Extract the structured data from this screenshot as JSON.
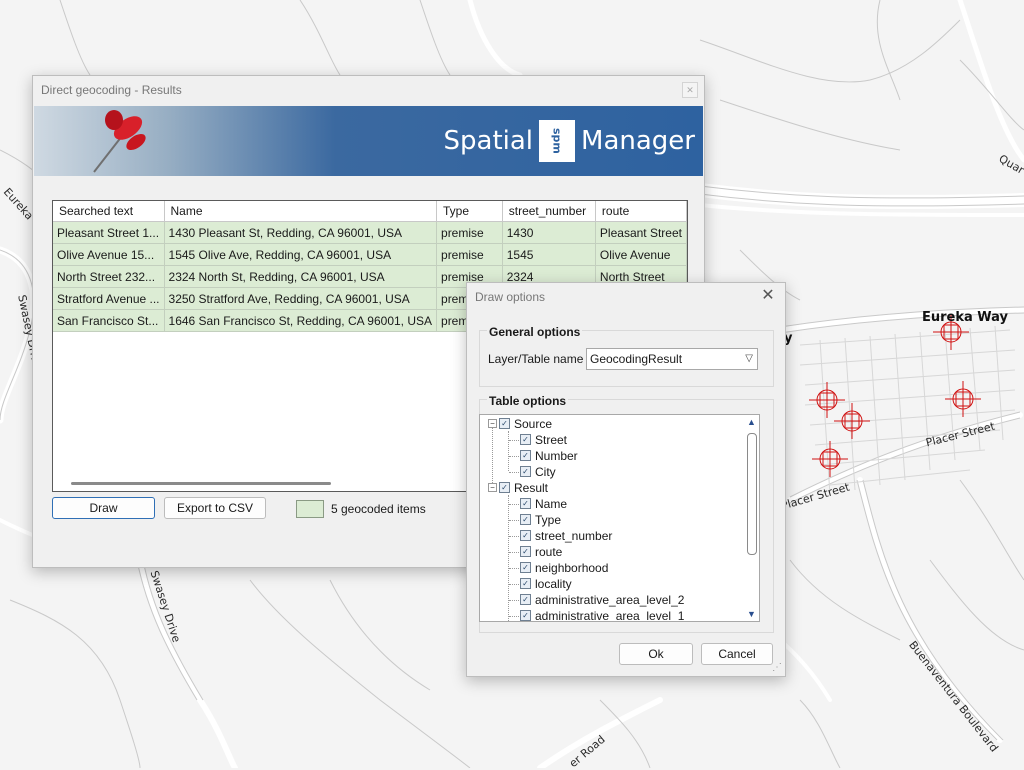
{
  "map": {
    "labels": [
      "Eureka Way",
      "Placer Street",
      "Placer Street",
      "Swasey Drive",
      "Swasey Drive",
      "Buenaventura Boulevard",
      "Eureka Wa",
      "Quar",
      "y",
      "er Road"
    ]
  },
  "results_dialog": {
    "title": "Direct geocoding - Results",
    "brand_left": "Spatial",
    "brand_badge": "spm",
    "brand_right": "Manager",
    "columns": [
      "Searched text",
      "Name",
      "Type",
      "street_number",
      "route"
    ],
    "rows": [
      [
        "Pleasant Street 1...",
        "1430 Pleasant St, Redding, CA 96001, USA",
        "premise",
        "1430",
        "Pleasant Street"
      ],
      [
        "Olive Avenue 15...",
        "1545 Olive Ave, Redding, CA 96001, USA",
        "premise",
        "1545",
        "Olive Avenue"
      ],
      [
        "North Street 232...",
        "2324 North St, Redding, CA 96001, USA",
        "premise",
        "2324",
        "North Street"
      ],
      [
        "Stratford Avenue ...",
        "3250 Stratford Ave, Redding, CA 96001, USA",
        "premise",
        "",
        ""
      ],
      [
        "San Francisco St...",
        "1646 San Francisco St, Redding, CA 96001, USA",
        "premise",
        "",
        ""
      ]
    ],
    "draw_label": "Draw",
    "export_label": "Export to CSV",
    "status": "5 geocoded items"
  },
  "draw_options": {
    "title": "Draw options",
    "general_title": "General options",
    "layer_label": "Layer/Table name",
    "layer_value": "GeocodingResult",
    "table_title": "Table options",
    "tree": {
      "source": "Source",
      "source_items": [
        "Street",
        "Number",
        "City"
      ],
      "result": "Result",
      "result_items": [
        "Name",
        "Type",
        "street_number",
        "route",
        "neighborhood",
        "locality",
        "administrative_area_level_2",
        "administrative_area_level_1"
      ]
    },
    "ok_label": "Ok",
    "cancel_label": "Cancel"
  },
  "colors": {
    "marker": "#d01010",
    "row_fill": "#dcecd4",
    "banner": "#2e62a0"
  }
}
